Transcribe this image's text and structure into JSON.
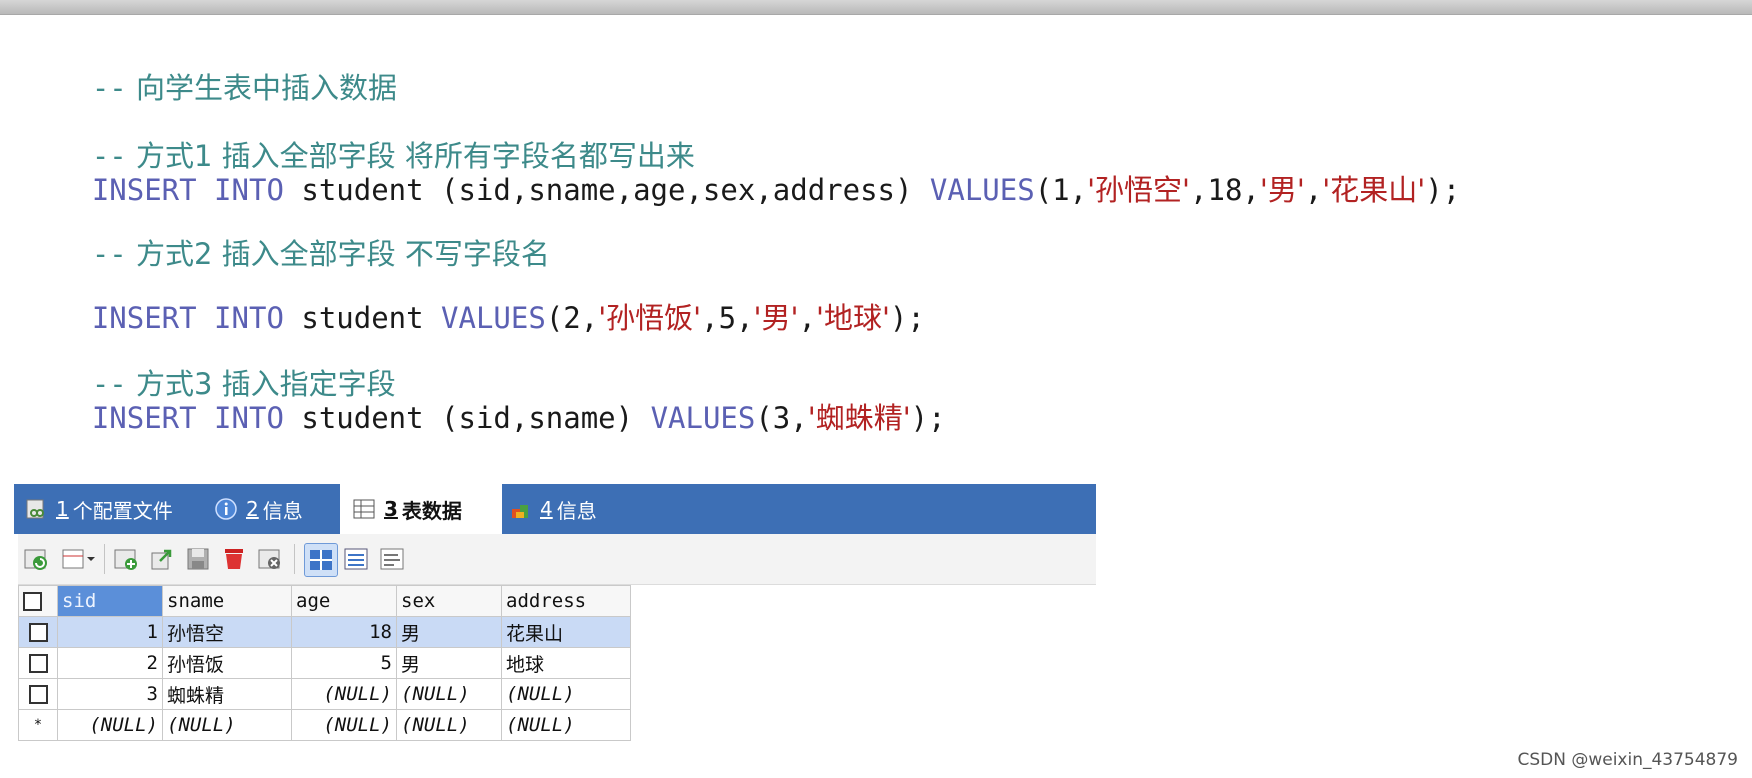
{
  "code": {
    "comment0": "向学生表中插入数据",
    "comment1": "方式1 插入全部字段 将所有字段名都写出来",
    "sql1": {
      "kw1": "INSERT INTO",
      "t1": " student (sid,sname,age,sex,address) ",
      "kw2": "VALUES",
      "t2": "(1,",
      "s1": "'孙悟空'",
      "t3": ",18,",
      "s2": "'男'",
      "t4": ",",
      "s3": "'花果山'",
      "t5": ");"
    },
    "comment2": "方式2 插入全部字段 不写字段名",
    "sql2": {
      "kw1": "INSERT INTO",
      "t1": " student ",
      "kw2": "VALUES",
      "t2": "(2,",
      "s1": "'孙悟饭'",
      "t3": ",5,",
      "s2": "'男'",
      "t4": ",",
      "s3": "'地球'",
      "t5": ");"
    },
    "comment3": "方式3 插入指定字段",
    "sql3": {
      "kw1": "INSERT INTO",
      "t1": " student (sid,sname) ",
      "kw2": "VALUES",
      "t2": "(3,",
      "s1": "'蜘蛛精'",
      "t3": ");"
    },
    "dash": "--"
  },
  "tabs": [
    {
      "num": "1",
      "label": "个配置文件"
    },
    {
      "num": "2",
      "label": "信息"
    },
    {
      "num": "3",
      "label": "表数据"
    },
    {
      "num": "4",
      "label": "信息"
    }
  ],
  "table": {
    "columns": [
      "sid",
      "sname",
      "age",
      "sex",
      "address"
    ],
    "rows": [
      {
        "sid": "1",
        "sname": "孙悟空",
        "age": "18",
        "sex": "男",
        "address": "花果山"
      },
      {
        "sid": "2",
        "sname": "孙悟饭",
        "age": "5",
        "sex": "男",
        "address": "地球"
      },
      {
        "sid": "3",
        "sname": "蜘蛛精",
        "age": "(NULL)",
        "sex": "(NULL)",
        "address": "(NULL)"
      },
      {
        "sid": "(NULL)",
        "sname": "(NULL)",
        "age": "(NULL)",
        "sex": "(NULL)",
        "address": "(NULL)"
      }
    ],
    "new_row_marker": "*"
  },
  "watermark": "CSDN @weixin_43754879",
  "colors": {
    "comment": "#3d8a8a",
    "keyword": "#5b60b3",
    "string": "#b22222",
    "tabbar": "#3d6fb5",
    "selection": "#c9daf5"
  }
}
